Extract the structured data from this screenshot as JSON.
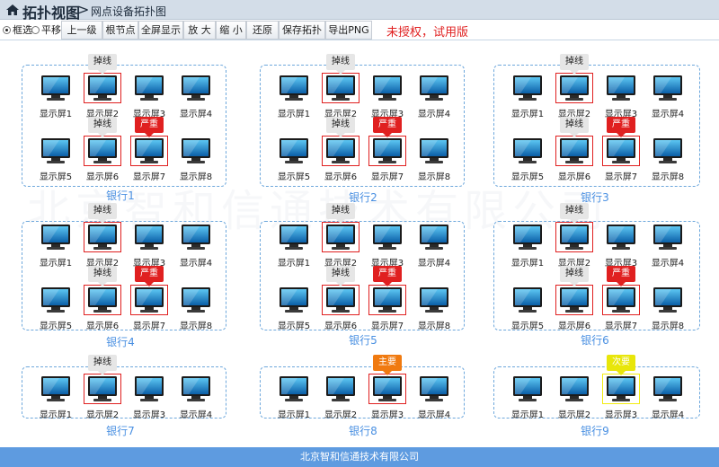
{
  "header": {
    "title": "拓扑视图",
    "chevron": ">",
    "breadcrumb": "网点设备拓扑图"
  },
  "toolbar": {
    "modes": [
      {
        "label": "框选",
        "selected": true
      },
      {
        "label": "平移",
        "selected": false
      }
    ],
    "buttons": [
      "上一级",
      "根节点",
      "全屏显示",
      "放 大",
      "缩 小",
      "还原",
      "保存拓扑",
      "导出PNG"
    ],
    "notice": "未授权，试用版"
  },
  "watermark": "北京智和信通技术有限公司",
  "status_labels": {
    "offline": "掉线",
    "severe": "严重",
    "major": "主要",
    "minor": "次要"
  },
  "colors": {
    "group_border": "#6ea8dc",
    "group_label": "#4a90e2",
    "severe": "#e02020",
    "major": "#f07a10",
    "minor": "#e8e60a",
    "footer_bg": "#5e9be0"
  },
  "groups": [
    {
      "label": "银行1",
      "devices": [
        {
          "label": "显示屏1"
        },
        {
          "label": "显示屏2",
          "status": "offline"
        },
        {
          "label": "显示屏3"
        },
        {
          "label": "显示屏4"
        },
        {
          "label": "显示屏5"
        },
        {
          "label": "显示屏6",
          "status": "offline"
        },
        {
          "label": "显示屏7",
          "status": "severe"
        },
        {
          "label": "显示屏8"
        }
      ]
    },
    {
      "label": "银行2",
      "devices": [
        {
          "label": "显示屏1"
        },
        {
          "label": "显示屏2",
          "status": "offline"
        },
        {
          "label": "显示屏3"
        },
        {
          "label": "显示屏4"
        },
        {
          "label": "显示屏5"
        },
        {
          "label": "显示屏6",
          "status": "offline"
        },
        {
          "label": "显示屏7",
          "status": "severe"
        },
        {
          "label": "显示屏8"
        }
      ]
    },
    {
      "label": "银行3",
      "devices": [
        {
          "label": "显示屏1"
        },
        {
          "label": "显示屏2",
          "status": "offline"
        },
        {
          "label": "显示屏3"
        },
        {
          "label": "显示屏4"
        },
        {
          "label": "显示屏5"
        },
        {
          "label": "显示屏6",
          "status": "offline"
        },
        {
          "label": "显示屏7",
          "status": "severe"
        },
        {
          "label": "显示屏8"
        }
      ]
    },
    {
      "label": "银行4",
      "devices": [
        {
          "label": "显示屏1"
        },
        {
          "label": "显示屏2",
          "status": "offline"
        },
        {
          "label": "显示屏3"
        },
        {
          "label": "显示屏4"
        },
        {
          "label": "显示屏5"
        },
        {
          "label": "显示屏6",
          "status": "offline"
        },
        {
          "label": "显示屏7",
          "status": "severe"
        },
        {
          "label": "显示屏8"
        }
      ]
    },
    {
      "label": "银行5",
      "devices": [
        {
          "label": "显示屏1"
        },
        {
          "label": "显示屏2",
          "status": "offline"
        },
        {
          "label": "显示屏3"
        },
        {
          "label": "显示屏4"
        },
        {
          "label": "显示屏5"
        },
        {
          "label": "显示屏6",
          "status": "offline"
        },
        {
          "label": "显示屏7",
          "status": "severe"
        },
        {
          "label": "显示屏8"
        }
      ]
    },
    {
      "label": "银行6",
      "devices": [
        {
          "label": "显示屏1"
        },
        {
          "label": "显示屏2",
          "status": "offline"
        },
        {
          "label": "显示屏3"
        },
        {
          "label": "显示屏4"
        },
        {
          "label": "显示屏5"
        },
        {
          "label": "显示屏6",
          "status": "offline"
        },
        {
          "label": "显示屏7",
          "status": "severe"
        },
        {
          "label": "显示屏8"
        }
      ]
    },
    {
      "label": "银行7",
      "devices": [
        {
          "label": "显示屏1"
        },
        {
          "label": "显示屏2",
          "status": "offline"
        },
        {
          "label": "显示屏3"
        },
        {
          "label": "显示屏4"
        }
      ]
    },
    {
      "label": "银行8",
      "devices": [
        {
          "label": "显示屏1"
        },
        {
          "label": "显示屏2"
        },
        {
          "label": "显示屏3",
          "status": "major"
        },
        {
          "label": "显示屏4"
        }
      ]
    },
    {
      "label": "银行9",
      "devices": [
        {
          "label": "显示屏1"
        },
        {
          "label": "显示屏2"
        },
        {
          "label": "显示屏3",
          "status": "minor"
        },
        {
          "label": "显示屏4"
        }
      ]
    }
  ],
  "footer": {
    "text": "北京智和信通技术有限公司"
  }
}
